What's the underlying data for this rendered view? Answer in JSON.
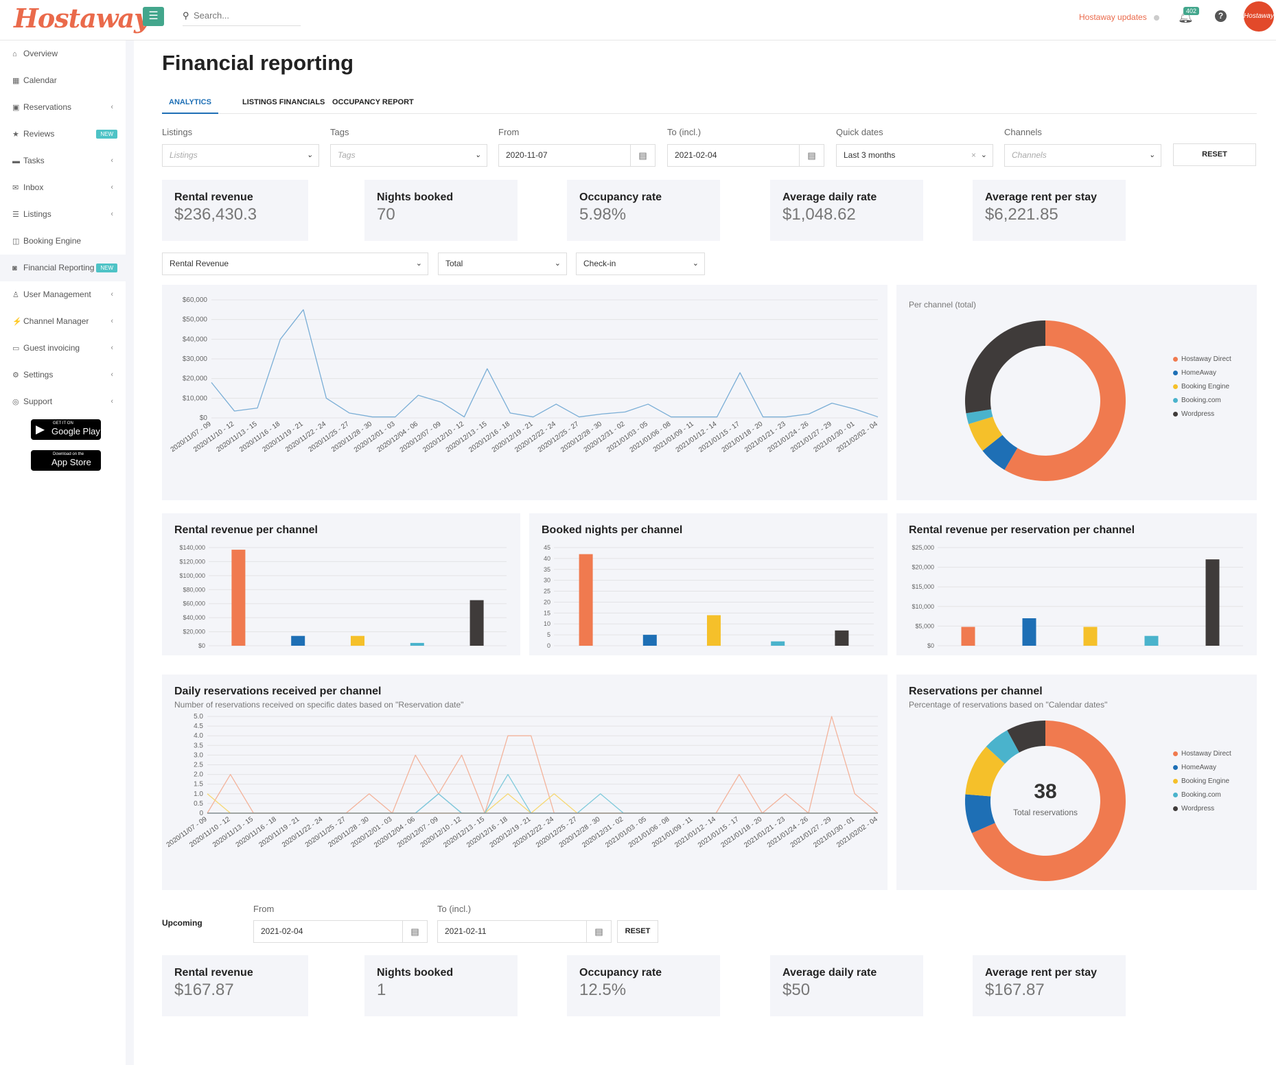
{
  "app": {
    "logo": "Hostaway",
    "search_placeholder": "Search...",
    "updates_label": "Hostaway updates",
    "notifications_count": "402",
    "help": "?",
    "avatar_text": "Hostaway"
  },
  "sidebar": {
    "items": [
      {
        "label": "Overview",
        "icon": "home-icon",
        "glyph": "⌂",
        "chevron": false
      },
      {
        "label": "Calendar",
        "icon": "calendar-icon",
        "glyph": "▦",
        "chevron": false
      },
      {
        "label": "Reservations",
        "icon": "calendar-check-icon",
        "glyph": "▣",
        "chevron": true
      },
      {
        "label": "Reviews",
        "icon": "star-icon",
        "glyph": "★",
        "chevron": false,
        "badge": "NEW"
      },
      {
        "label": "Tasks",
        "icon": "briefcase-icon",
        "glyph": "▬",
        "chevron": true
      },
      {
        "label": "Inbox",
        "icon": "chat-icon",
        "glyph": "✉",
        "chevron": true
      },
      {
        "label": "Listings",
        "icon": "list-icon",
        "glyph": "☰",
        "chevron": true
      },
      {
        "label": "Booking Engine",
        "icon": "window-icon",
        "glyph": "◫",
        "chevron": false
      },
      {
        "label": "Financial Reporting",
        "icon": "money-icon",
        "glyph": "◙",
        "chevron": false,
        "badge": "NEW",
        "active": true
      },
      {
        "label": "User Management",
        "icon": "user-icon",
        "glyph": "♙",
        "chevron": true
      },
      {
        "label": "Channel Manager",
        "icon": "plug-icon",
        "glyph": "⚡",
        "chevron": true
      },
      {
        "label": "Guest invoicing",
        "icon": "card-icon",
        "glyph": "▭",
        "chevron": true
      },
      {
        "label": "Settings",
        "icon": "gears-icon",
        "glyph": "⚙",
        "chevron": true
      },
      {
        "label": "Support",
        "icon": "lifebuoy-icon",
        "glyph": "◎",
        "chevron": true
      }
    ],
    "google_play": {
      "small": "GET IT ON",
      "large": "Google Play"
    },
    "app_store": {
      "small": "Download on the",
      "large": "App Store"
    }
  },
  "page": {
    "title": "Financial reporting",
    "tabs": [
      "ANALYTICS",
      "LISTINGS FINANCIALS",
      "OCCUPANCY REPORT"
    ],
    "filters": {
      "listings_label": "Listings",
      "listings_placeholder": "Listings",
      "tags_label": "Tags",
      "tags_placeholder": "Tags",
      "from_label": "From",
      "from_value": "2020-11-07",
      "to_label": "To (incl.)",
      "to_value": "2021-02-04",
      "quick_label": "Quick dates",
      "quick_value": "Last 3 months",
      "channels_label": "Channels",
      "channels_placeholder": "Channels",
      "reset": "RESET"
    },
    "kpis": [
      {
        "label": "Rental revenue",
        "value": "$236,430.3"
      },
      {
        "label": "Nights booked",
        "value": "70"
      },
      {
        "label": "Occupancy rate",
        "value": "5.98%"
      },
      {
        "label": "Average daily rate",
        "value": "$1,048.62"
      },
      {
        "label": "Average rent per stay",
        "value": "$6,221.85"
      }
    ],
    "selectors": {
      "metric": "Rental Revenue",
      "agg": "Total",
      "date_type": "Check-in"
    },
    "upcoming": {
      "label": "Upcoming",
      "from_label": "From",
      "from_value": "2021-02-04",
      "to_label": "To (incl.)",
      "to_value": "2021-02-11",
      "reset": "RESET",
      "kpis": [
        {
          "label": "Rental revenue",
          "value": "$167.87"
        },
        {
          "label": "Nights booked",
          "value": "1"
        },
        {
          "label": "Occupancy rate",
          "value": "12.5%"
        },
        {
          "label": "Average daily rate",
          "value": "$50"
        },
        {
          "label": "Average rent per stay",
          "value": "$167.87"
        }
      ]
    }
  },
  "colors": {
    "hostaway_direct": "#f07a4f",
    "homeaway": "#1e6fb5",
    "booking_engine": "#f5c02a",
    "booking_com": "#4ab3cc",
    "wordpress": "#3f3b3a",
    "line": "#7aaed6"
  },
  "chart_data": [
    {
      "id": "revenue-line",
      "type": "line",
      "title": "",
      "x": [
        "2020/11/07 - 09",
        "2020/11/10 - 12",
        "2020/11/13 - 15",
        "2020/11/16 - 18",
        "2020/11/19 - 21",
        "2020/11/22 - 24",
        "2020/11/25 - 27",
        "2020/11/28 - 30",
        "2020/12/01 - 03",
        "2020/12/04 - 06",
        "2020/12/07 - 09",
        "2020/12/10 - 12",
        "2020/12/13 - 15",
        "2020/12/16 - 18",
        "2020/12/19 - 21",
        "2020/12/22 - 24",
        "2020/12/25 - 27",
        "2020/12/28 - 30",
        "2020/12/31 - 02",
        "2021/01/03 - 05",
        "2021/01/06 - 08",
        "2021/01/09 - 11",
        "2021/01/12 - 14",
        "2021/01/15 - 17",
        "2021/01/18 - 20",
        "2021/01/21 - 23",
        "2021/01/24 - 26",
        "2021/01/27 - 29",
        "2021/01/30 - 01",
        "2021/02/02 - 04"
      ],
      "values": [
        18000,
        3500,
        5000,
        40000,
        55000,
        10000,
        2500,
        500,
        500,
        11500,
        8000,
        500,
        25000,
        2500,
        500,
        7000,
        500,
        2000,
        3000,
        7000,
        500,
        500,
        500,
        23000,
        500,
        500,
        2000,
        7500,
        4500,
        500
      ],
      "ylim": [
        0,
        60000
      ],
      "yticks": [
        "$0",
        "$10,000",
        "$20,000",
        "$30,000",
        "$40,000",
        "$50,000",
        "$60,000"
      ]
    },
    {
      "id": "channel-donut-total",
      "type": "pie",
      "title": "Per channel (total)",
      "categories": [
        "Hostaway Direct",
        "HomeAway",
        "Booking Engine",
        "Booking.com",
        "Wordpress"
      ],
      "values": [
        58.5,
        5.8,
        6.0,
        2.2,
        27.5
      ]
    },
    {
      "id": "revenue-per-channel",
      "type": "bar",
      "title": "Rental revenue per channel",
      "categories": [
        "Hostaway Direct",
        "HomeAway",
        "Booking Engine",
        "Booking.com",
        "Wordpress"
      ],
      "values": [
        137000,
        14000,
        14000,
        4000,
        65000
      ],
      "ylim": [
        0,
        140000
      ],
      "yticks": [
        "$0",
        "$20,000",
        "$40,000",
        "$60,000",
        "$80,000",
        "$100,000",
        "$120,000",
        "$140,000"
      ]
    },
    {
      "id": "nights-per-channel",
      "type": "bar",
      "title": "Booked nights per channel",
      "categories": [
        "Hostaway Direct",
        "HomeAway",
        "Booking Engine",
        "Booking.com",
        "Wordpress"
      ],
      "values": [
        42,
        5,
        14,
        2,
        7
      ],
      "ylim": [
        0,
        45
      ],
      "yticks": [
        "0",
        "5",
        "10",
        "15",
        "20",
        "25",
        "30",
        "35",
        "40",
        "45"
      ]
    },
    {
      "id": "revenue-per-reservation-per-channel",
      "type": "bar",
      "title": "Rental revenue per reservation per channel",
      "categories": [
        "Hostaway Direct",
        "HomeAway",
        "Booking Engine",
        "Booking.com",
        "Wordpress"
      ],
      "values": [
        4800,
        7000,
        4800,
        2500,
        22000
      ],
      "ylim": [
        0,
        25000
      ],
      "yticks": [
        "$0",
        "$5,000",
        "$10,000",
        "$15,000",
        "$20,000",
        "$25,000"
      ]
    },
    {
      "id": "daily-reservations",
      "type": "line",
      "title": "Daily reservations received per channel",
      "subtitle": "Number of reservations received on specific dates based on \"Reservation date\"",
      "x": [
        "2020/11/07 - 09",
        "2020/11/10 - 12",
        "2020/11/13 - 15",
        "2020/11/16 - 18",
        "2020/11/19 - 21",
        "2020/11/22 - 24",
        "2020/11/25 - 27",
        "2020/11/28 - 30",
        "2020/12/01 - 03",
        "2020/12/04 - 06",
        "2020/12/07 - 09",
        "2020/12/10 - 12",
        "2020/12/13 - 15",
        "2020/12/16 - 18",
        "2020/12/19 - 21",
        "2020/12/22 - 24",
        "2020/12/25 - 27",
        "2020/12/28 - 30",
        "2020/12/31 - 02",
        "2021/01/03 - 05",
        "2021/01/06 - 08",
        "2021/01/09 - 11",
        "2021/01/12 - 14",
        "2021/01/15 - 17",
        "2021/01/18 - 20",
        "2021/01/21 - 23",
        "2021/01/24 - 26",
        "2021/01/27 - 29",
        "2021/01/30 - 01",
        "2021/02/02 - 04"
      ],
      "series": [
        {
          "name": "Hostaway Direct",
          "values": [
            0,
            2,
            0,
            0,
            0,
            0,
            0,
            1,
            0,
            3,
            1,
            3,
            0,
            4,
            4,
            0,
            0,
            0,
            0,
            0,
            0,
            0,
            0,
            2,
            0,
            1,
            0,
            5,
            1,
            0
          ]
        },
        {
          "name": "HomeAway",
          "values": [
            0,
            0,
            0,
            0,
            0,
            0,
            0,
            0,
            0,
            0,
            1,
            0,
            0,
            0,
            0,
            0,
            0,
            0,
            0,
            0,
            0,
            0,
            0,
            0,
            0,
            0,
            0,
            0,
            0,
            0
          ]
        },
        {
          "name": "Booking Engine",
          "values": [
            1,
            0,
            0,
            0,
            0,
            0,
            0,
            0,
            0,
            0,
            0,
            0,
            0,
            1,
            0,
            1,
            0,
            0,
            0,
            0,
            0,
            0,
            0,
            0,
            0,
            0,
            0,
            0,
            0,
            0
          ]
        },
        {
          "name": "Booking.com",
          "values": [
            0,
            0,
            0,
            0,
            0,
            0,
            0,
            0,
            0,
            0,
            1,
            0,
            0,
            2,
            0,
            0,
            0,
            1,
            0,
            0,
            0,
            0,
            0,
            0,
            0,
            0,
            0,
            0,
            0,
            0
          ]
        },
        {
          "name": "Wordpress",
          "values": [
            0,
            0,
            0,
            0,
            0,
            0,
            0,
            0,
            0,
            0,
            0,
            0,
            0,
            0,
            0,
            0,
            0,
            0,
            0,
            0,
            0,
            0,
            0,
            0,
            0,
            0,
            0,
            0,
            0,
            0
          ]
        }
      ],
      "ylim": [
        0,
        5
      ],
      "yticks": [
        "0",
        "0.5",
        "1.0",
        "1.5",
        "2.0",
        "2.5",
        "3.0",
        "3.5",
        "4.0",
        "4.5",
        "5.0"
      ]
    },
    {
      "id": "reservations-donut",
      "type": "pie",
      "title": "Reservations per channel",
      "subtitle": "Percentage of reservations based on \"Calendar dates\"",
      "center_value": "38",
      "center_label": "Total reservations",
      "categories": [
        "Hostaway Direct",
        "HomeAway",
        "Booking Engine",
        "Booking.com",
        "Wordpress"
      ],
      "values": [
        68.4,
        7.9,
        10.5,
        5.3,
        7.9
      ]
    }
  ]
}
